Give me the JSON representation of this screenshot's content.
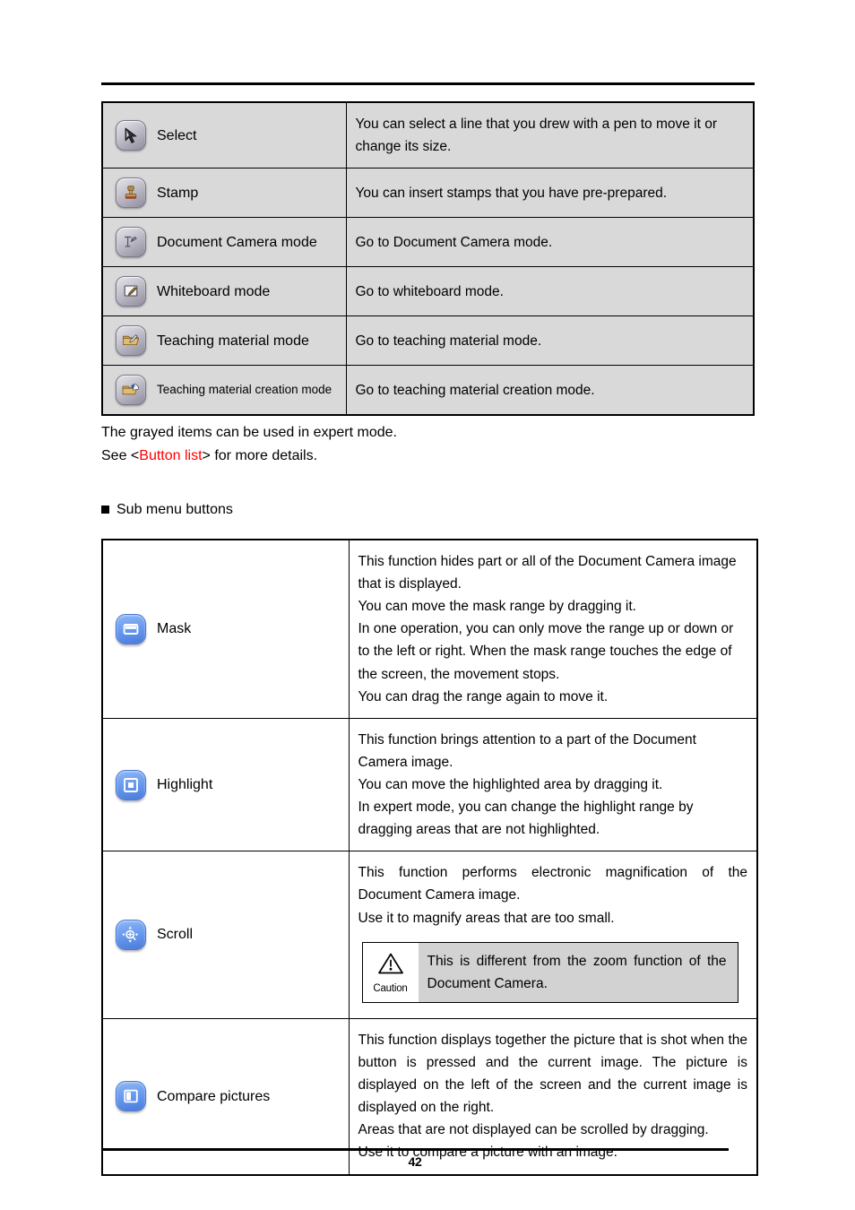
{
  "page": {
    "number": "42"
  },
  "mode_table": {
    "rows": [
      {
        "icon": "select-arrow-icon",
        "label": "Select",
        "description": "You can select a line that you drew with a pen to move it or change its size."
      },
      {
        "icon": "stamp-icon",
        "label": "Stamp",
        "description": "You can insert stamps that you have pre-prepared."
      },
      {
        "icon": "document-camera-icon",
        "label": "Document Camera mode",
        "description": "Go to Document Camera mode."
      },
      {
        "icon": "whiteboard-icon",
        "label": "Whiteboard mode",
        "description": "Go to whiteboard mode."
      },
      {
        "icon": "teaching-material-folder-icon",
        "label": "Teaching material mode",
        "description": "Go to teaching material mode."
      },
      {
        "icon": "teaching-material-creation-folder-icon",
        "label": "Teaching material creation mode",
        "description": "Go to teaching material creation mode."
      }
    ]
  },
  "notes": {
    "expert_mode": "The grayed items can be used in expert mode.",
    "see_prefix": "See <",
    "see_link": "Button list",
    "see_suffix": "> for more details."
  },
  "section": {
    "submenu_heading": "Sub menu buttons"
  },
  "submenu_table": {
    "rows": [
      {
        "icon": "mask-icon",
        "label": "Mask",
        "paragraphs": [
          "This function hides part or all of the Document Camera image that is displayed.",
          "You can move the mask range by dragging it.",
          "In one operation, you can only move the range up or down or to the left or right. When the mask range touches the edge of the screen, the movement stops.",
          "You can drag the range again to move it."
        ]
      },
      {
        "icon": "highlight-icon",
        "label": "Highlight",
        "paragraphs": [
          "This function brings attention to a part of the Document Camera image.",
          "You can move the highlighted area by dragging it.",
          "In expert mode, you can change the highlight range by dragging areas that are not highlighted."
        ]
      },
      {
        "icon": "scroll-magnify-icon",
        "label": "Scroll",
        "paragraphs": [
          "This function performs electronic magnification of the Document Camera image.",
          "Use it to magnify areas that are too small."
        ],
        "caution": {
          "icon": "warning-triangle-icon",
          "word": "Caution",
          "text": "This is different from the zoom function of the Document Camera."
        }
      },
      {
        "icon": "compare-pictures-icon",
        "label": "Compare pictures",
        "paragraphs": [
          "This function displays together the picture that is shot when the button is pressed and the current image. The picture is displayed on the left of the screen and the current image is displayed on the right.",
          "Areas that are not displayed can be scrolled by dragging.",
          "Use it to compare a picture with an image."
        ]
      }
    ]
  },
  "colors": {
    "link_red": "#ff0000",
    "table1_cell_bg": "#d9d9d9",
    "caution_bg": "#d2d2d2",
    "blue_button": "#5c8ee8"
  }
}
